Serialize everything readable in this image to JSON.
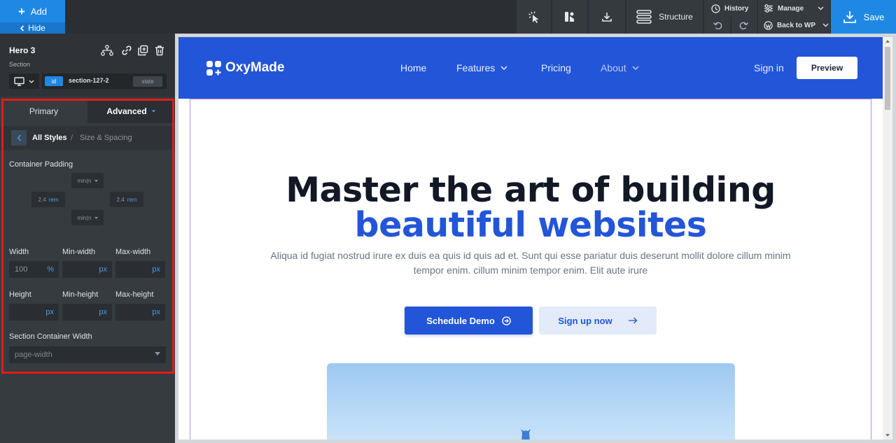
{
  "toolbar": {
    "add_label": "Add",
    "hide_label": "Hide",
    "structure_label": "Structure",
    "history_label": "History",
    "manage_label": "Manage",
    "back_to_wp_label": "Back to WP",
    "save_label": "Save"
  },
  "panel": {
    "element_title": "Hero 3",
    "element_type": "Section",
    "id_badge": "id",
    "id_value": "section-127-2",
    "state_label": "state",
    "tabs": [
      {
        "label": "Primary"
      },
      {
        "label": "Advanced"
      }
    ],
    "breadcrumb": {
      "current": "All Styles",
      "separator": "/",
      "sub": "Size & Spacing"
    },
    "container_padding": {
      "label": "Container Padding",
      "top_value": "min(n",
      "left_value": "2.4",
      "left_unit": "rem",
      "right_value": "2.4",
      "right_unit": "rem",
      "bottom_value": "min(n"
    },
    "size_fields": {
      "width_label": "Width",
      "min_width_label": "Min-width",
      "max_width_label": "Max-width",
      "width_value": "100",
      "width_unit": "%",
      "min_width_unit": "px",
      "max_width_unit": "px",
      "height_label": "Height",
      "min_height_label": "Min-height",
      "max_height_label": "Max-height",
      "height_unit": "px",
      "min_height_unit": "px",
      "max_height_unit": "px"
    },
    "container_width": {
      "label": "Section Container Width",
      "value": "page-width"
    }
  },
  "site": {
    "logo_text": "OxyMade",
    "nav": [
      {
        "label": "Home"
      },
      {
        "label": "Features"
      },
      {
        "label": "Pricing"
      },
      {
        "label": "About"
      }
    ],
    "signin_label": "Sign in",
    "preview_label": "Preview",
    "hero": {
      "title_line1": "Master the art of building",
      "title_line2": "beautiful websites",
      "subtitle": "Aliqua id fugiat nostrud irure ex duis ea quis id quis ad et. Sunt qui esse pariatur duis deserunt mollit dolore cillum minim tempor enim. cillum minim tempor enim. Elit aute irure",
      "primary_cta": "Schedule Demo",
      "secondary_cta": "Sign up now"
    }
  },
  "colors": {
    "accent": "#1f88e5",
    "brand_blue": "#2355d8",
    "highlight_red": "#e31b1b"
  }
}
